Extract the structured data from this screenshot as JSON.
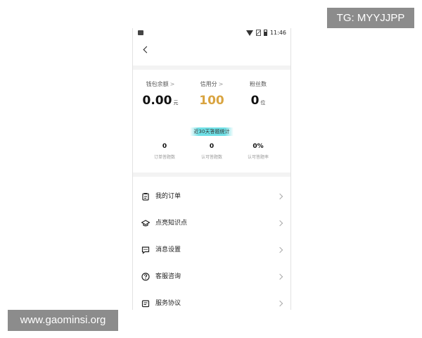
{
  "watermarks": {
    "top": "TG: MYYJJPP",
    "bottom": "www.gaominsi.org"
  },
  "status_bar": {
    "time": "11:46"
  },
  "stats": [
    {
      "label": "钱包余额",
      "chevron": ">",
      "value": "0.00",
      "unit": "元"
    },
    {
      "label": "信用分",
      "chevron": ">",
      "value": "100",
      "unit": ""
    },
    {
      "label": "粉丝数",
      "chevron": "",
      "value": "0",
      "unit": "位"
    }
  ],
  "badge": "近30天答题统计",
  "answer_stats": [
    {
      "value": "0",
      "label": "订单答题数"
    },
    {
      "value": "0",
      "label": "认可答题数"
    },
    {
      "value": "0%",
      "label": "认可答题率"
    }
  ],
  "menu": [
    {
      "label": "我的订单",
      "icon": "clipboard-icon"
    },
    {
      "label": "点亮知识点",
      "icon": "graduation-cap-icon"
    },
    {
      "label": "消息设置",
      "icon": "message-icon"
    },
    {
      "label": "客服咨询",
      "icon": "help-icon"
    },
    {
      "label": "服务协议",
      "icon": "document-icon"
    }
  ],
  "colors": {
    "credit": "#d9a441",
    "badge": "#6fe0e6",
    "separator": "#f3f3f3"
  }
}
